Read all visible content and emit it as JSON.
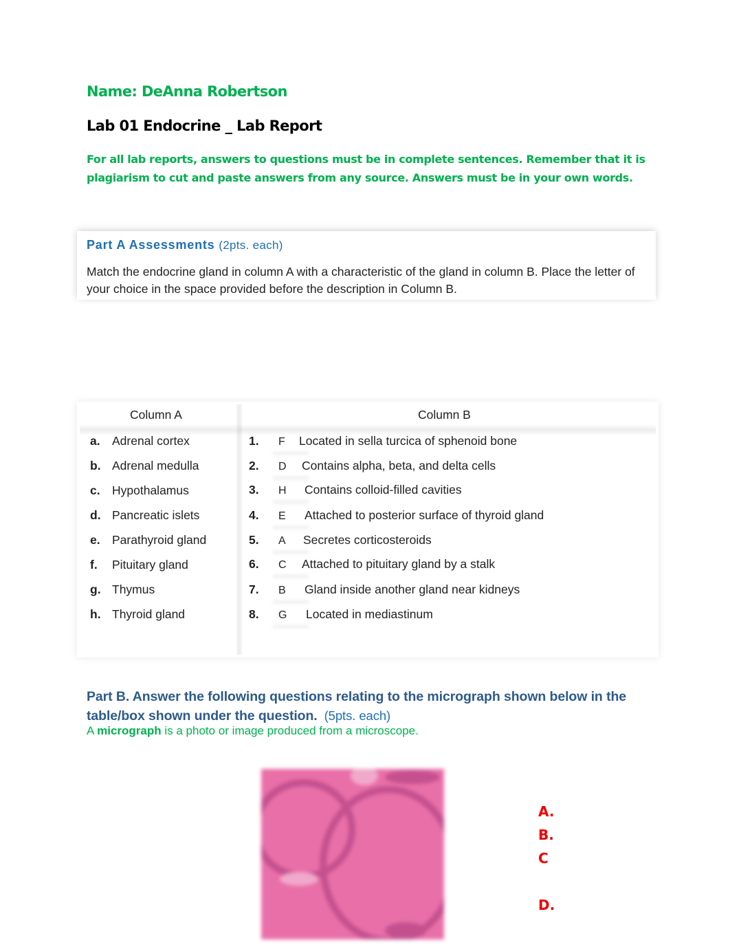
{
  "header": {
    "name_line": "Name: DeAnna Robertson",
    "lab_title": "Lab 01 Endocrine _ Lab Report",
    "instructions": "For all lab reports, answers to questions must be in complete sentences.  Remember that it is plagiarism to cut and paste answers from any source.  Answers must be in your own words."
  },
  "part_a": {
    "title": "Part A Assessments",
    "points": "(2pts. each)",
    "instructions": "Match the endocrine gland in column A with a characteristic of the gland in column B. Place the letter of your choice in the space provided before the description in Column B.",
    "column_a_header": "Column A",
    "column_b_header": "Column B",
    "column_a": [
      {
        "letter": "a.",
        "gland": "Adrenal cortex"
      },
      {
        "letter": "b.",
        "gland": "Adrenal medulla"
      },
      {
        "letter": "c.",
        "gland": "Hypothalamus"
      },
      {
        "letter": "d.",
        "gland": "Pancreatic islets"
      },
      {
        "letter": "e.",
        "gland": "Parathyroid gland"
      },
      {
        "letter": "f.",
        "gland": "Pituitary gland"
      },
      {
        "letter": "g.",
        "gland": "Thymus"
      },
      {
        "letter": "h.",
        "gland": "Thyroid gland"
      }
    ],
    "column_b": [
      {
        "number": "1.",
        "answer": "F",
        "description": "Located in sella turcica of sphenoid bone"
      },
      {
        "number": "2.",
        "answer": "D",
        "description": "Contains alpha, beta, and delta cells"
      },
      {
        "number": "3.",
        "answer": "H",
        "description": "Contains colloid-filled cavities"
      },
      {
        "number": "4.",
        "answer": "E",
        "description": "Attached to posterior surface of thyroid gland"
      },
      {
        "number": "5.",
        "answer": "A",
        "description": "Secretes corticosteroids"
      },
      {
        "number": "6.",
        "answer": "C",
        "description": "Attached to pituitary gland by a stalk"
      },
      {
        "number": "7.",
        "answer": "B",
        "description": "Gland inside another gland near kidneys"
      },
      {
        "number": "8.",
        "answer": "G",
        "description": "Located in mediastinum"
      }
    ]
  },
  "part_b": {
    "title": "Part B. Answer the following questions relating to the micrograph shown below in the table/box shown under the question.",
    "points": "(5pts. each)",
    "definition_prefix": "A ",
    "definition_term": "micrograph",
    "definition_rest": " is a photo or image produced from a microscope.",
    "micrograph_labels": [
      "A.",
      "B.",
      "C",
      "D."
    ],
    "micrograph_colors": {
      "base": "#e96fa8",
      "dark": "#c4508f",
      "light": "#f1a9cb"
    }
  }
}
